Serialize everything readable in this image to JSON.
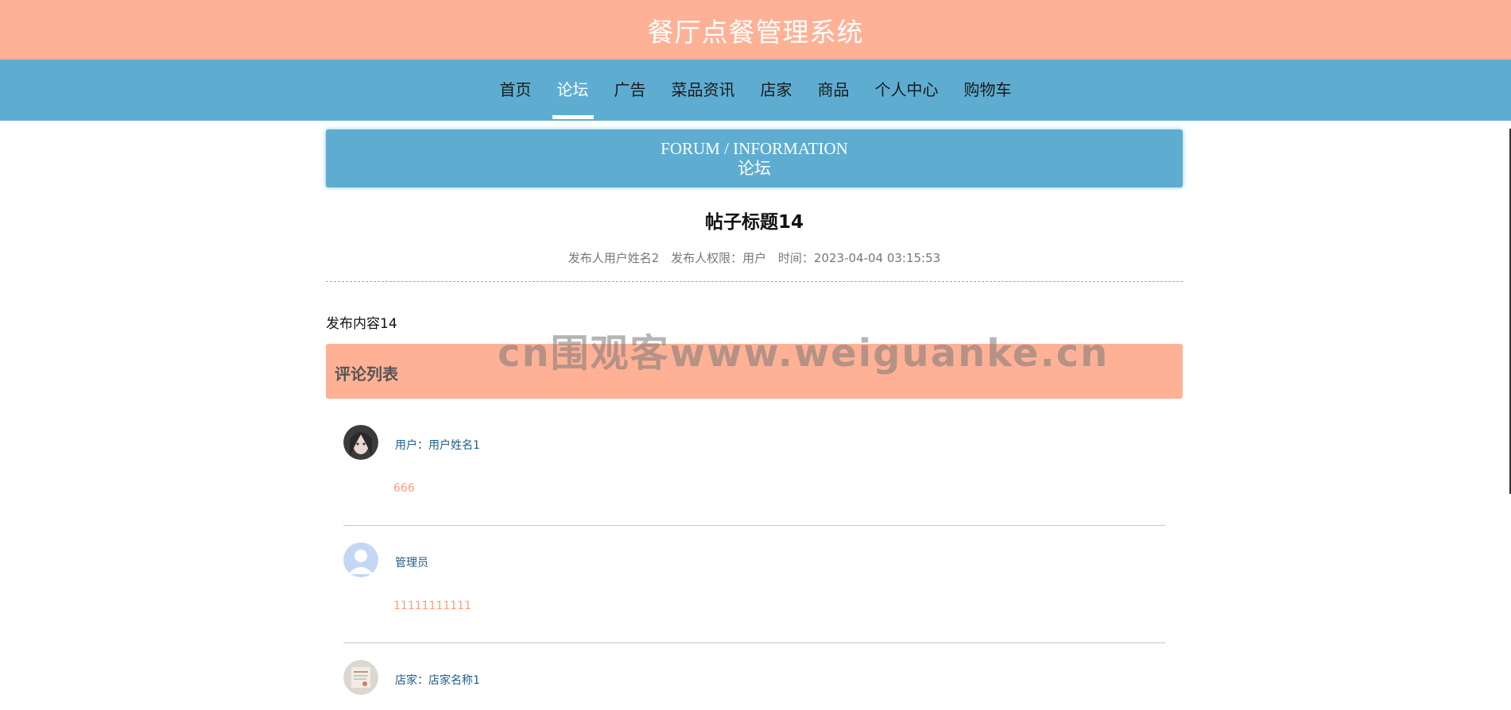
{
  "site": {
    "title": "餐厅点餐管理系统"
  },
  "nav": {
    "items": [
      {
        "label": "首页"
      },
      {
        "label": "论坛",
        "active": true
      },
      {
        "label": "广告"
      },
      {
        "label": "菜品资讯"
      },
      {
        "label": "店家"
      },
      {
        "label": "商品"
      },
      {
        "label": "个人中心"
      },
      {
        "label": "购物车"
      }
    ]
  },
  "banner": {
    "en": "FORUM / INFORMATION",
    "cn": "论坛"
  },
  "post": {
    "title": "帖子标题14",
    "author": "发布人用户姓名2",
    "role": "发布人权限：用户",
    "time": "时间：2023-04-04 03:15:53",
    "content": "发布内容14"
  },
  "watermark": "cn围观客www.weiguanke.cn",
  "comments": {
    "header": "评论列表",
    "items": [
      {
        "user": "用户：用户姓名1",
        "text": "666",
        "avatar": "photo-avatar-icon"
      },
      {
        "user": "管理员",
        "text": "11111111111",
        "avatar": "default-user-avatar-icon"
      },
      {
        "user": "店家：店家名称1",
        "text": "",
        "avatar": "certificate-avatar-icon"
      }
    ]
  },
  "colors": {
    "topbar": "#ffb196",
    "navbar": "#5eadd1",
    "comment_user": "#1c5f8a",
    "comment_text": "#ff9c7a"
  }
}
